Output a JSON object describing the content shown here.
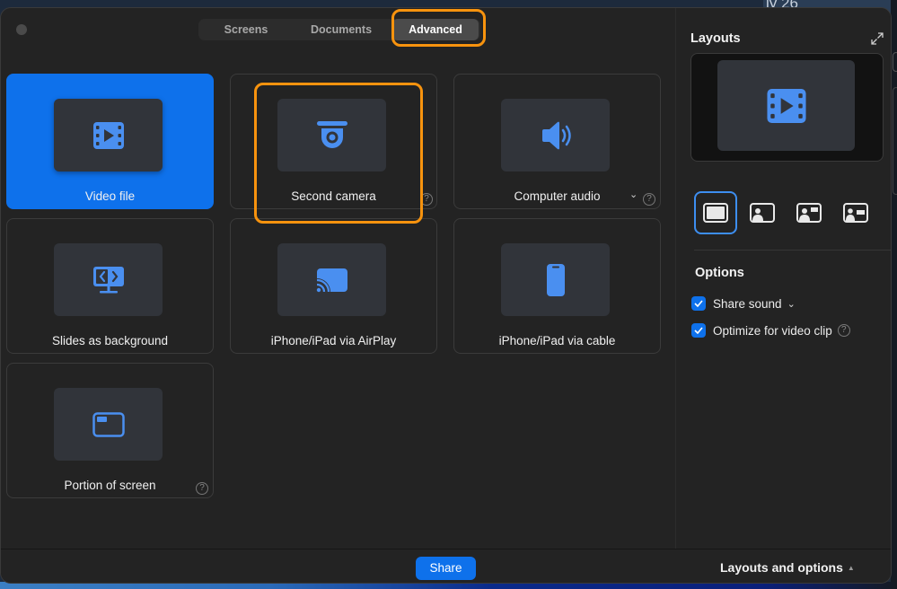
{
  "background": {
    "desktop_text": "ly 26"
  },
  "window": {
    "tabs": [
      {
        "label": "Screens",
        "active": false
      },
      {
        "label": "Documents",
        "active": false
      },
      {
        "label": "Advanced",
        "active": true,
        "highlighted": true
      }
    ],
    "options_grid": [
      {
        "label": "Video file",
        "icon": "film-play-icon",
        "selected": true,
        "help": false,
        "dropdown": false
      },
      {
        "label": "Second camera",
        "icon": "dome-camera-icon",
        "selected": false,
        "highlighted": true,
        "help": true,
        "dropdown": false
      },
      {
        "label": "Computer audio",
        "icon": "speaker-icon",
        "selected": false,
        "help": true,
        "dropdown": true
      },
      {
        "label": "Slides as background",
        "icon": "slides-monitor-icon",
        "selected": false,
        "help": false,
        "dropdown": false
      },
      {
        "label": "iPhone/iPad via AirPlay",
        "icon": "airplay-cast-icon",
        "selected": false,
        "help": false,
        "dropdown": false
      },
      {
        "label": "iPhone/iPad via cable",
        "icon": "phone-icon",
        "selected": false,
        "help": false,
        "dropdown": false
      },
      {
        "label": "Portion of screen",
        "icon": "screen-portion-icon",
        "selected": false,
        "help": true,
        "dropdown": false
      }
    ],
    "help_glyph": "?",
    "chevron_glyph": "⌄"
  },
  "sidebar": {
    "layouts_title": "Layouts",
    "layout_options": [
      {
        "name": "full-screen",
        "active": true
      },
      {
        "name": "presenter-left",
        "active": false
      },
      {
        "name": "presenter-with-bar",
        "active": false
      },
      {
        "name": "presenter-with-label",
        "active": false
      }
    ],
    "options_title": "Options",
    "options": [
      {
        "label": "Share sound",
        "checked": true,
        "dropdown": true,
        "help": false
      },
      {
        "label": "Optimize for video clip",
        "checked": true,
        "dropdown": false,
        "help": true
      }
    ]
  },
  "footer": {
    "share_label": "Share",
    "layouts_toggle_label": "Layouts and options",
    "layouts_toggle_arrow": "▲"
  },
  "colors": {
    "accent_blue": "#0e71eb",
    "icon_blue": "#4a8ff0",
    "highlight_orange": "#f7930e",
    "window_bg": "#232323"
  }
}
